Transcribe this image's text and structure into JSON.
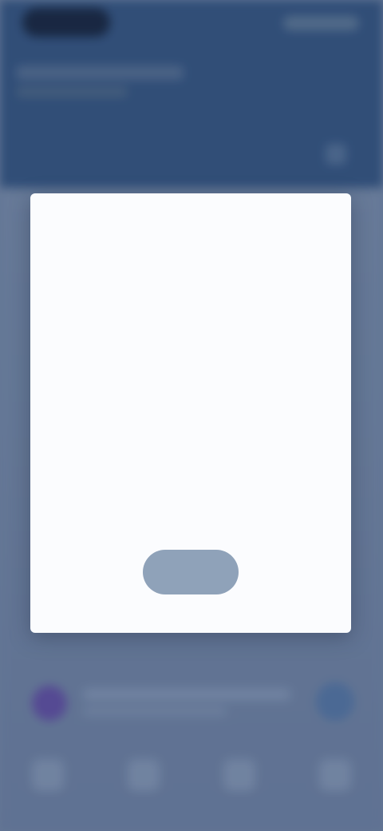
{
  "status_bar": {
    "time": ""
  },
  "dialog": {
    "title": "",
    "paragraph_1": "",
    "paragraph_2": "",
    "button_label": ""
  },
  "colors": {
    "header_bg": "#2f4f7a",
    "page_bg": "#6b7f9d",
    "dialog_bg": "#fbfcfe",
    "button_bg": "#8fa2b9",
    "accent_avatar": "#5a4a9a",
    "accent_fab": "#4e6f9c"
  },
  "icons": {
    "header_action": "menu-icon",
    "fab": "add-icon",
    "nav": [
      "home-icon",
      "search-icon",
      "messages-icon",
      "profile-icon"
    ]
  }
}
